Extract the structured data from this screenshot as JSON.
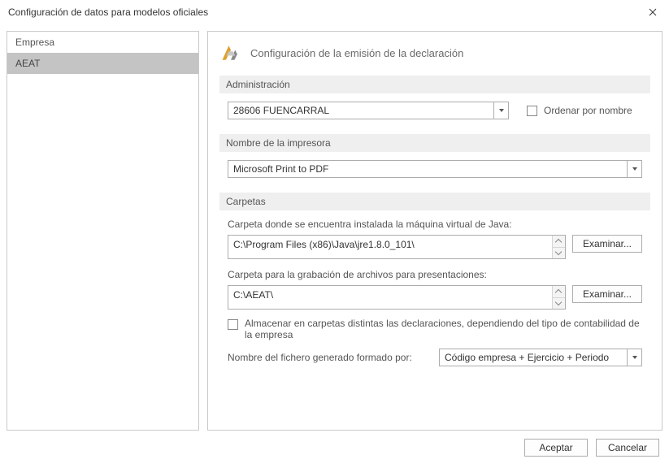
{
  "window": {
    "title": "Configuración de datos para modelos oficiales"
  },
  "sidebar": {
    "items": [
      {
        "label": "Empresa",
        "selected": false
      },
      {
        "label": "AEAT",
        "selected": true
      }
    ]
  },
  "main": {
    "page_title": "Configuración de la emisión de la declaración",
    "admin": {
      "header": "Administración",
      "selected": "28606 FUENCARRAL",
      "sort_by_name_label": "Ordenar por nombre"
    },
    "printer": {
      "header": "Nombre de la impresora",
      "selected": "Microsoft Print to PDF"
    },
    "folders": {
      "header": "Carpetas",
      "java_label": "Carpeta donde se encuentra instalada la máquina virtual de Java:",
      "java_value": "C:\\Program Files (x86)\\Java\\jre1.8.0_101\\",
      "present_label": "Carpeta para la grabación de archivos para presentaciones:",
      "present_value": "C:\\AEAT\\",
      "browse_label": "Examinar...",
      "split_folders_label": "Almacenar en carpetas distintas las declaraciones, dependiendo del tipo de contabilidad de la empresa",
      "filename_label": "Nombre del fichero generado formado por:",
      "filename_option": "Código empresa + Ejercicio + Periodo"
    }
  },
  "buttons": {
    "ok": "Aceptar",
    "cancel": "Cancelar"
  }
}
